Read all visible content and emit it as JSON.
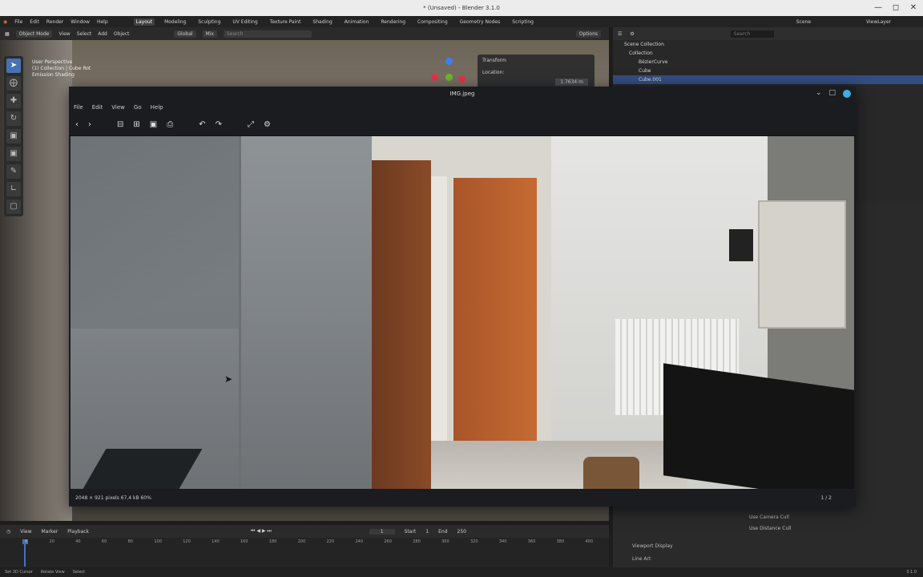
{
  "window_title": "* (Unsaved) - Blender 3.1.0",
  "top_menu": {
    "items": [
      "File",
      "Edit",
      "Render",
      "Window",
      "Help"
    ],
    "workspaces": [
      "Layout",
      "Modeling",
      "Sculpting",
      "UV Editing",
      "Texture Paint",
      "Shading",
      "Animation",
      "Rendering",
      "Compositing",
      "Geometry Nodes",
      "Scripting"
    ],
    "active_workspace": "Layout",
    "scene_label": "Scene",
    "view_layer_label": "ViewLayer"
  },
  "viewport_header": {
    "mode": "Object Mode",
    "menus": [
      "View",
      "Select",
      "Add",
      "Object"
    ],
    "orientation": "Global",
    "snap": "Mix",
    "search_placeholder": "Search",
    "options": "Options"
  },
  "viewport_overlay": {
    "line1": "User Perspective",
    "line2": "(1) Collection | Cube Rot",
    "line3": "Emission Shading"
  },
  "transform_panel": {
    "title": "Transform",
    "location_label": "Location:",
    "x_value": "1.7634 m"
  },
  "outliner": {
    "search_placeholder": "Search",
    "root": "Scene Collection",
    "items": [
      "Collection",
      "BézierCurve",
      "Cube",
      "Cube.001"
    ]
  },
  "properties": {
    "use_camera_cull": "Use Camera Cull",
    "use_distance_cull": "Use Distance Cull",
    "viewport_display": "Viewport Display",
    "use_art": "Line Art"
  },
  "timeline": {
    "menus": [
      "View",
      "Marker",
      "Playback"
    ],
    "current_frame": "1",
    "start_label": "Start",
    "start_value": "1",
    "end_label": "End",
    "end_value": "250",
    "ticks": [
      "0",
      "20",
      "40",
      "60",
      "80",
      "100",
      "120",
      "140",
      "160",
      "180",
      "200",
      "220",
      "240",
      "260",
      "280",
      "300",
      "320",
      "340",
      "360",
      "380",
      "400"
    ]
  },
  "status_bar": {
    "items": [
      "Set 3D Cursor",
      "Rotate View",
      "Select"
    ],
    "version": "3.1.0"
  },
  "image_viewer": {
    "title": "IMG.jpeg",
    "menus": [
      "File",
      "Edit",
      "View",
      "Go",
      "Help"
    ],
    "status": "2048 × 921 pixels  67,4 kB  60%",
    "page": "1 / 2"
  }
}
